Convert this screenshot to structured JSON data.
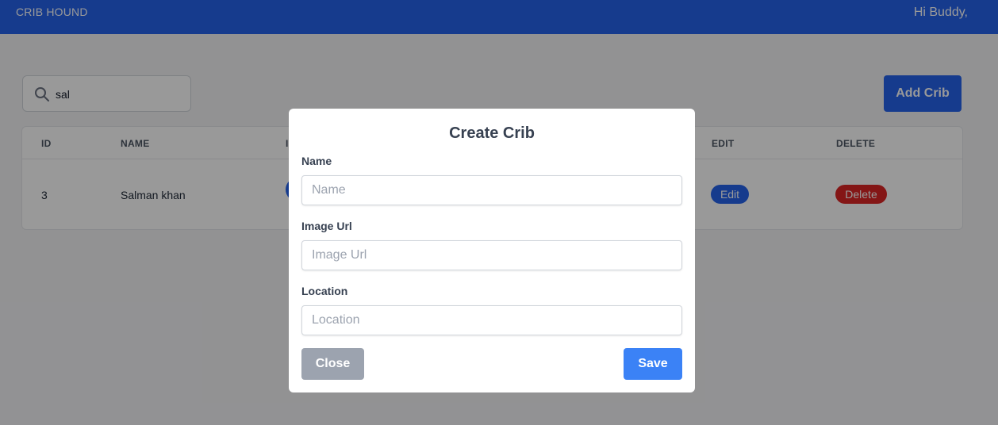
{
  "header": {
    "brand": "CRIB HOUND",
    "greeting": "Hi Buddy,"
  },
  "search": {
    "value": "sal",
    "icon": "search-icon"
  },
  "toolbar": {
    "add_label": "Add Crib"
  },
  "table": {
    "columns": [
      "ID",
      "NAME",
      "I",
      "EDIT",
      "DELETE"
    ],
    "rows": [
      {
        "id": "3",
        "name": "Salman khan",
        "edit_label": "Edit",
        "delete_label": "Delete"
      }
    ]
  },
  "modal": {
    "title": "Create Crib",
    "fields": [
      {
        "label": "Name",
        "placeholder": "Name",
        "value": ""
      },
      {
        "label": "Image Url",
        "placeholder": "Image Url",
        "value": ""
      },
      {
        "label": "Location",
        "placeholder": "Location",
        "value": ""
      }
    ],
    "close_label": "Close",
    "save_label": "Save"
  },
  "colors": {
    "primary": "#2563eb",
    "save": "#3b82f6",
    "danger": "#dc2626",
    "close": "#9ca3af",
    "overlay": "rgba(0,0,0,0.4)"
  }
}
